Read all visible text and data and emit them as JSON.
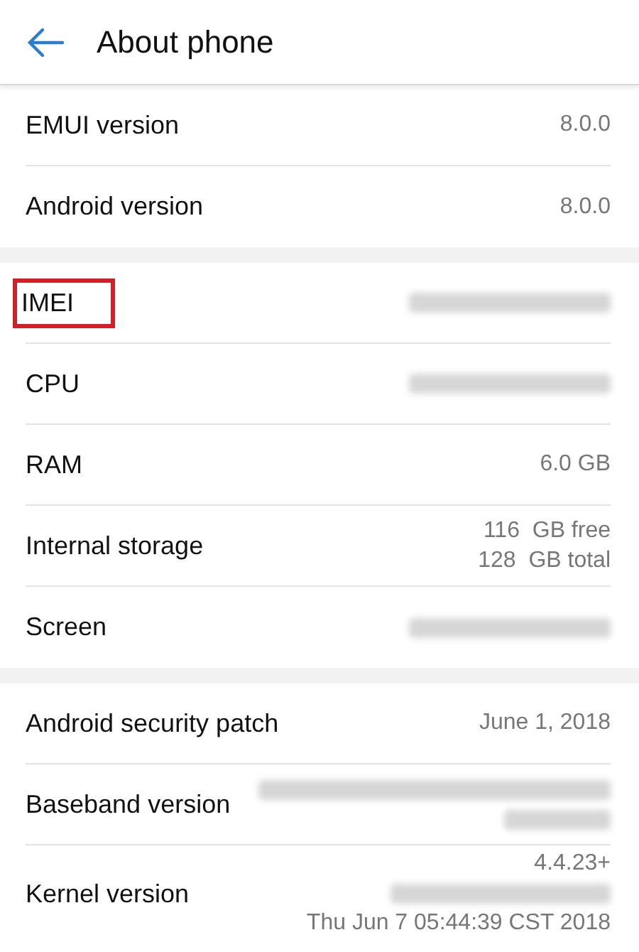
{
  "header": {
    "title": "About phone"
  },
  "sections": [
    {
      "rows": [
        {
          "label": "EMUI version",
          "highlighted": false,
          "values": [
            {
              "kind": "text",
              "text": "8.0.0"
            }
          ]
        },
        {
          "label": "Android version",
          "highlighted": false,
          "values": [
            {
              "kind": "text",
              "text": "8.0.0"
            }
          ]
        }
      ]
    },
    {
      "rows": [
        {
          "label": "IMEI",
          "highlighted": true,
          "values": [
            {
              "kind": "redacted"
            }
          ]
        },
        {
          "label": "CPU",
          "highlighted": false,
          "values": [
            {
              "kind": "redacted"
            }
          ]
        },
        {
          "label": "RAM",
          "highlighted": false,
          "values": [
            {
              "kind": "text",
              "text": "6.0 GB"
            }
          ]
        },
        {
          "label": "Internal storage",
          "highlighted": false,
          "values": [
            {
              "kind": "text",
              "text": "116  GB free"
            },
            {
              "kind": "text",
              "text": "128  GB total"
            }
          ]
        },
        {
          "label": "Screen",
          "highlighted": false,
          "values": [
            {
              "kind": "redacted"
            }
          ]
        }
      ]
    },
    {
      "rows": [
        {
          "label": "Android security patch",
          "highlighted": false,
          "values": [
            {
              "kind": "text",
              "text": "June 1, 2018"
            }
          ]
        },
        {
          "label": "Baseband version",
          "highlighted": false,
          "values": [
            {
              "kind": "redacted"
            },
            {
              "kind": "redacted"
            }
          ]
        },
        {
          "label": "Kernel version",
          "highlighted": false,
          "values": [
            {
              "kind": "text",
              "text": "4.4.23+"
            },
            {
              "kind": "redacted"
            },
            {
              "kind": "text",
              "text": "Thu Jun 7 05:44:39 CST 2018"
            }
          ]
        }
      ]
    }
  ]
}
